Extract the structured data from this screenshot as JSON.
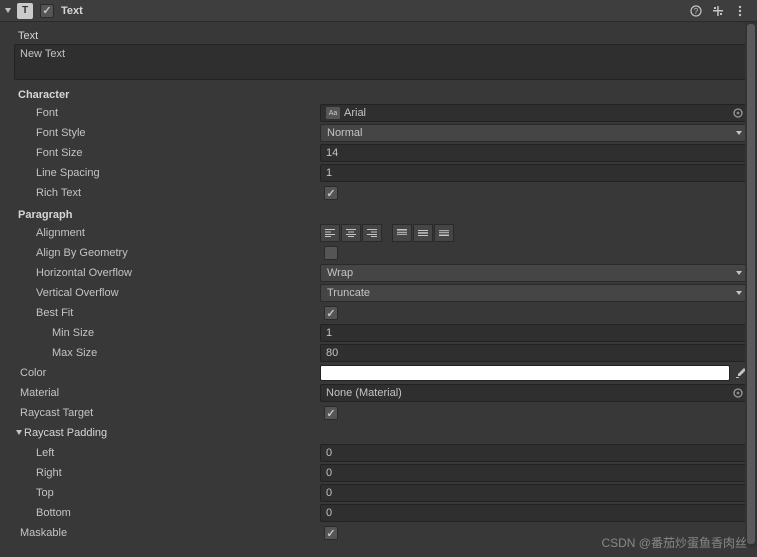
{
  "header": {
    "icon_letter": "T",
    "title": "Text"
  },
  "text": {
    "label": "Text",
    "value": "New Text"
  },
  "character": {
    "title": "Character",
    "font": {
      "label": "Font",
      "value": "Arial",
      "prefix": "Aa"
    },
    "font_style": {
      "label": "Font Style",
      "value": "Normal"
    },
    "font_size": {
      "label": "Font Size",
      "value": "14"
    },
    "line_spacing": {
      "label": "Line Spacing",
      "value": "1"
    },
    "rich_text": {
      "label": "Rich Text",
      "checked": true
    }
  },
  "paragraph": {
    "title": "Paragraph",
    "alignment": {
      "label": "Alignment"
    },
    "align_by_geometry": {
      "label": "Align By Geometry",
      "checked": false
    },
    "horizontal_overflow": {
      "label": "Horizontal Overflow",
      "value": "Wrap"
    },
    "vertical_overflow": {
      "label": "Vertical Overflow",
      "value": "Truncate"
    },
    "best_fit": {
      "label": "Best Fit",
      "checked": true
    },
    "min_size": {
      "label": "Min Size",
      "value": "1"
    },
    "max_size": {
      "label": "Max Size",
      "value": "80"
    }
  },
  "color": {
    "label": "Color",
    "value": "#ffffff"
  },
  "material": {
    "label": "Material",
    "value": "None (Material)"
  },
  "raycast_target": {
    "label": "Raycast Target",
    "checked": true
  },
  "raycast_padding": {
    "title": "Raycast Padding",
    "left": {
      "label": "Left",
      "value": "0"
    },
    "right": {
      "label": "Right",
      "value": "0"
    },
    "top": {
      "label": "Top",
      "value": "0"
    },
    "bottom": {
      "label": "Bottom",
      "value": "0"
    }
  },
  "maskable": {
    "label": "Maskable",
    "checked": true
  },
  "watermark": "CSDN @番茄炒蛋鱼香肉丝"
}
